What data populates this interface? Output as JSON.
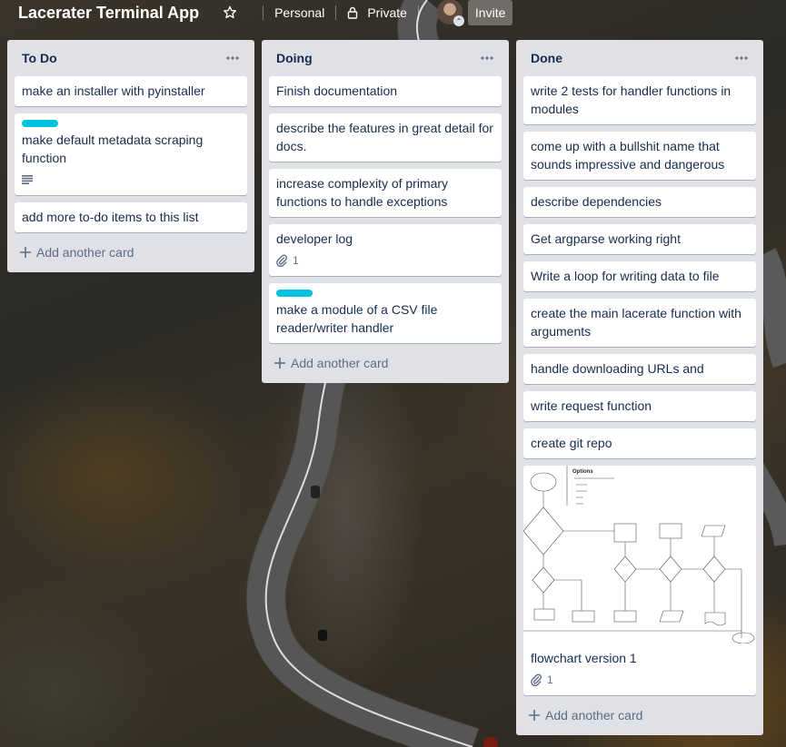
{
  "board": {
    "title": "Lacerater Terminal App",
    "team_label": "Personal",
    "visibility_label": "Private",
    "invite_label": "Invite",
    "add_card_label": "Add another card"
  },
  "icons": {
    "star": "star-icon",
    "lock": "lock-icon",
    "more": "more-dots-icon",
    "plus": "plus-icon",
    "description": "description-icon",
    "attachment": "paperclip-icon"
  },
  "colors": {
    "label_cyan": "#00c2e0",
    "list_bg": "#dfe1e6"
  },
  "lists": [
    {
      "title": "To Do",
      "cards": [
        {
          "text": "make an installer with pyinstaller"
        },
        {
          "text": "make default metadata scraping function",
          "label": true,
          "description": true
        },
        {
          "text": "add more to-do items to this list"
        }
      ]
    },
    {
      "title": "Doing",
      "cards": [
        {
          "text": "Finish documentation"
        },
        {
          "text": "describe the features in great detail for docs."
        },
        {
          "text": "increase complexity of primary functions to handle exceptions"
        },
        {
          "text": "developer log",
          "attachments": "1"
        },
        {
          "text": "make a module of a CSV file reader/writer handler",
          "label": true
        }
      ]
    },
    {
      "title": "Done",
      "cards": [
        {
          "text": "write 2 tests for handler functions in modules"
        },
        {
          "text": "come up with a bullshit name that sounds impressive and dangerous"
        },
        {
          "text": "describe dependencies"
        },
        {
          "text": "Get argparse working right"
        },
        {
          "text": "Write a loop for writing data to file"
        },
        {
          "text": "create the main lacerate function with arguments"
        },
        {
          "text": "handle downloading URLs and"
        },
        {
          "text": "write request function"
        },
        {
          "text": "create git repo"
        },
        {
          "text": "flowchart version 1",
          "attachments": "1",
          "cover": true
        }
      ]
    }
  ],
  "flowchart_cover": {
    "heading": "Options"
  }
}
